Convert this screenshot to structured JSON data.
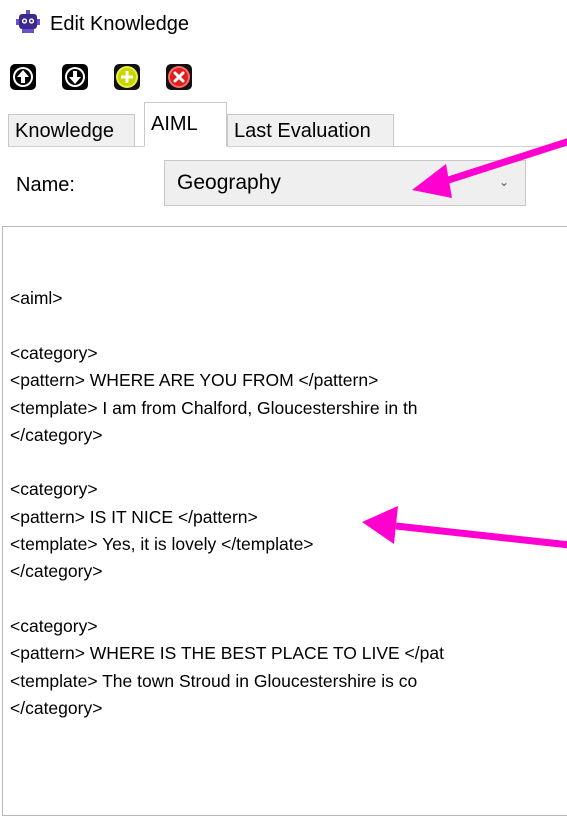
{
  "window": {
    "title": "Edit Knowledge",
    "icon": "robot-app-icon"
  },
  "toolbar": {
    "buttons": [
      {
        "name": "move-up",
        "icon": "arrow-up-circle-icon"
      },
      {
        "name": "move-down",
        "icon": "arrow-down-circle-icon"
      },
      {
        "name": "add",
        "icon": "plus-circle-icon",
        "color": "#c9d600"
      },
      {
        "name": "delete",
        "icon": "x-circle-icon",
        "color": "#e02020"
      }
    ]
  },
  "tabs": [
    {
      "label": "Knowledge",
      "active": false
    },
    {
      "label": "AIML",
      "active": true
    },
    {
      "label": "Last Evaluation",
      "active": false
    }
  ],
  "name_field": {
    "label": "Name:",
    "value": "Geography"
  },
  "editor": {
    "lines": [
      "",
      "<aiml>",
      "",
      "<category>",
      "<pattern> WHERE ARE YOU FROM </pattern>",
      "<template> I am from Chalford, Gloucestershire in th",
      "</category>",
      "",
      "<category>",
      "<pattern> IS IT NICE </pattern>",
      "<template> Yes, it is lovely </template>",
      "</category>",
      "",
      "<category>",
      "<pattern> WHERE IS THE BEST PLACE TO LIVE </pat",
      "<template> The town Stroud in Gloucestershire is co",
      "</category>",
      "",
      ""
    ]
  },
  "annotations": {
    "arrow_color": "#ff00d0"
  }
}
